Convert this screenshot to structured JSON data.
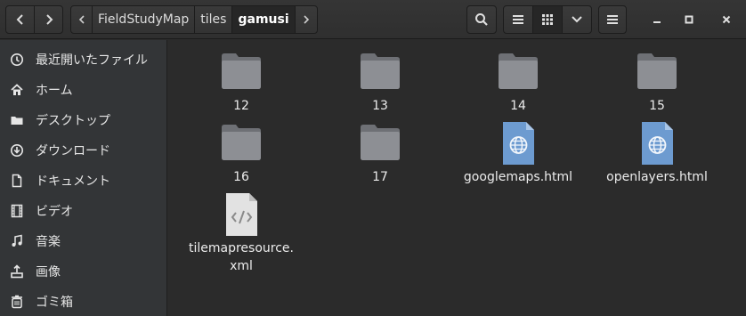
{
  "header": {
    "back_icon": "go-previous-icon",
    "forward_icon": "go-next-icon",
    "path": [
      "FieldStudyMap",
      "tiles",
      "gamusi"
    ],
    "search_icon": "search-icon",
    "view_list_icon": "view-list-icon",
    "view_grid_icon": "view-grid-icon",
    "view_options_icon": "chevron-down-icon",
    "menu_icon": "hamburger-menu-icon"
  },
  "sidebar": {
    "items": [
      {
        "label": "最近開いたファイル",
        "icon": "recent-icon"
      },
      {
        "label": "ホーム",
        "icon": "home-icon"
      },
      {
        "label": "デスクトップ",
        "icon": "desktop-folder-icon"
      },
      {
        "label": "ダウンロード",
        "icon": "download-icon"
      },
      {
        "label": "ドキュメント",
        "icon": "document-icon"
      },
      {
        "label": "ビデオ",
        "icon": "video-icon"
      },
      {
        "label": "音楽",
        "icon": "music-icon"
      },
      {
        "label": "画像",
        "icon": "pictures-icon"
      },
      {
        "label": "ゴミ箱",
        "icon": "trash-icon"
      }
    ]
  },
  "files": [
    {
      "name": "12",
      "type": "folder"
    },
    {
      "name": "13",
      "type": "folder"
    },
    {
      "name": "14",
      "type": "folder"
    },
    {
      "name": "15",
      "type": "folder"
    },
    {
      "name": "16",
      "type": "folder"
    },
    {
      "name": "17",
      "type": "folder"
    },
    {
      "name": "googlemaps.html",
      "type": "html"
    },
    {
      "name": "openlayers.html",
      "type": "html"
    },
    {
      "name_line1": "tilemapresource.",
      "name_line2": "xml",
      "type": "xml"
    }
  ],
  "colors": {
    "folder": "#8d8f94",
    "html_file": "#6d9bd0",
    "xml_file": "#e2e2e2"
  }
}
